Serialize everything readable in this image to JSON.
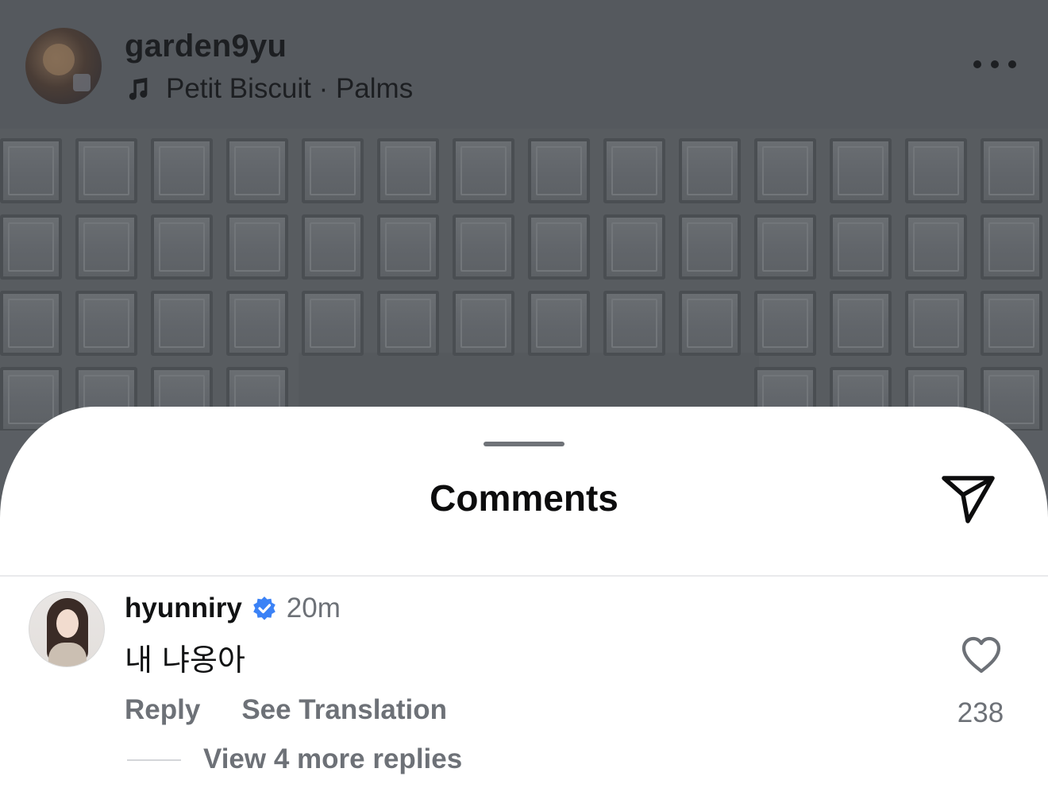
{
  "post": {
    "username": "garden9yu",
    "music_icon": "music-note-icon",
    "music_label": "Petit Biscuit · Palms",
    "more_icon": "ellipsis-icon"
  },
  "sheet": {
    "title": "Comments",
    "share_icon": "send-icon"
  },
  "comment": {
    "username": "hyunniry",
    "verified_icon": "verified-badge-icon",
    "time": "20m",
    "text": "내 냐옹아",
    "reply_label": "Reply",
    "translate_label": "See Translation",
    "like_icon": "heart-icon",
    "like_count": "238",
    "view_replies_label": "View 4 more replies"
  },
  "colors": {
    "overlay": "#5a5e63",
    "sheet_bg": "#ffffff",
    "secondary_text": "#6d7177",
    "verified": "#3b82f6"
  }
}
